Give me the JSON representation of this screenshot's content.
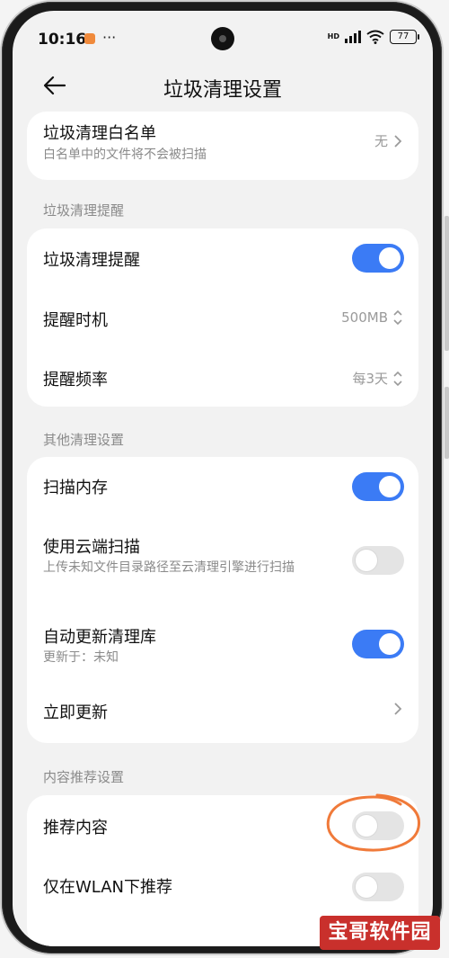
{
  "status_bar": {
    "time": "10:16",
    "more": "···",
    "network_label": "HD",
    "battery": "77"
  },
  "header": {
    "title": "垃圾清理设置"
  },
  "whitelist": {
    "label": "垃圾清理白名单",
    "description": "白名单中的文件将不会被扫描",
    "value": "无"
  },
  "section_reminder": {
    "title": "垃圾清理提醒",
    "items": [
      {
        "label": "垃圾清理提醒",
        "toggle": true
      },
      {
        "label": "提醒时机",
        "value": "500MB"
      },
      {
        "label": "提醒频率",
        "value": "每3天"
      }
    ]
  },
  "section_other": {
    "title": "其他清理设置",
    "items": [
      {
        "label": "扫描内存",
        "toggle": true
      },
      {
        "label": "使用云端扫描",
        "description": "上传未知文件目录路径至云清理引擎进行扫描",
        "toggle": false
      },
      {
        "label": "自动更新清理库",
        "description": "更新于：未知",
        "toggle": true
      },
      {
        "label": "立即更新"
      }
    ]
  },
  "section_content": {
    "title": "内容推荐设置",
    "items": [
      {
        "label": "推荐内容",
        "toggle": false
      },
      {
        "label": "仅在WLAN下推荐",
        "toggle": false
      }
    ]
  },
  "watermark": "宝哥软件园",
  "colors": {
    "toggle_on": "#3b7bf5",
    "toggle_off": "#e4e4e4",
    "annotation": "#f07a3a",
    "watermark": "#c9302c"
  }
}
